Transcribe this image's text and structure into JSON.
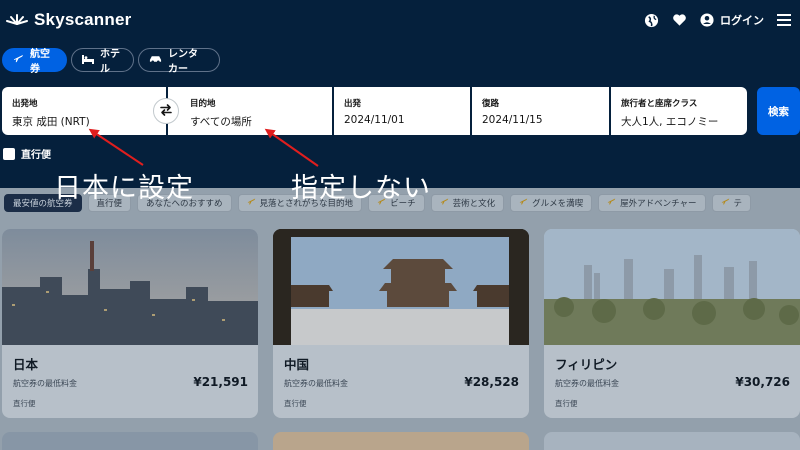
{
  "header": {
    "brand": "Skyscanner",
    "login_label": "ログイン",
    "icons": [
      "sunrise-logo-icon",
      "globe-icon",
      "heart-icon",
      "user-icon",
      "menu-icon"
    ]
  },
  "tabs": [
    {
      "label": "航空券",
      "icon": "plane-icon",
      "active": true
    },
    {
      "label": "ホテル",
      "icon": "bed-icon",
      "active": false
    },
    {
      "label": "レンタカー",
      "icon": "car-icon",
      "active": false
    }
  ],
  "search": {
    "origin": {
      "label": "出発地",
      "value": "東京 成田 (NRT)"
    },
    "destination": {
      "label": "目的地",
      "value": "すべての場所"
    },
    "depart": {
      "label": "出発",
      "value": "2024/11/01"
    },
    "return": {
      "label": "復路",
      "value": "2024/11/15"
    },
    "travellers": {
      "label": "旅行者と座席クラス",
      "value": "大人1人, エコノミー"
    },
    "button_label": "検索",
    "direct_label": "直行便"
  },
  "annotations": {
    "left": "日本に設定",
    "right": "指定しない"
  },
  "chips": [
    {
      "label": "最安値の航空券",
      "active": true
    },
    {
      "label": "直行便"
    },
    {
      "label": "あなたへのおすすめ"
    },
    {
      "label": "見落とされがちな目的地"
    },
    {
      "label": "ビーチ"
    },
    {
      "label": "芸術と文化"
    },
    {
      "label": "グルメを満喫"
    },
    {
      "label": "屋外アドベンチャー"
    },
    {
      "label": "テ"
    }
  ],
  "cards": [
    {
      "title": "日本",
      "subtitle": "航空券の最低料金",
      "price": "¥21,591",
      "tag": "直行便"
    },
    {
      "title": "中国",
      "subtitle": "航空券の最低料金",
      "price": "¥28,528",
      "tag": "直行便"
    },
    {
      "title": "フィリピン",
      "subtitle": "航空券の最低料金",
      "price": "¥30,726",
      "tag": "直行便"
    }
  ],
  "colors": {
    "background": "#05203c",
    "accent": "#0062e3",
    "annotation_arrow": "#e01e1e",
    "overlay": "#93a0ac"
  }
}
